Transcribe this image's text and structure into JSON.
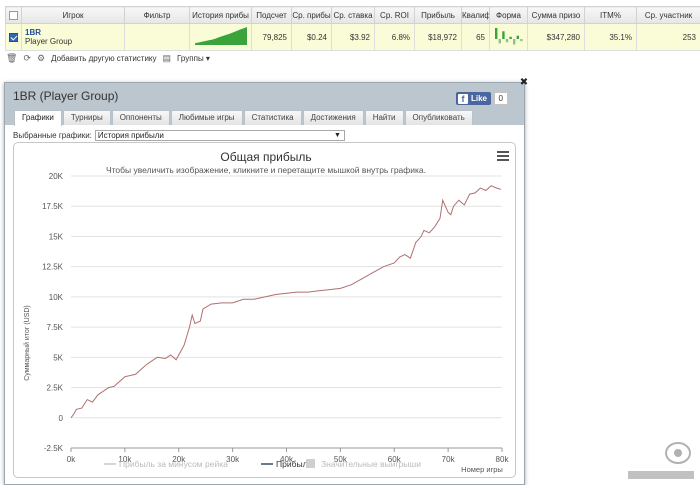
{
  "table": {
    "headers": [
      "",
      "Игрок",
      "Фильтр",
      "История прибы",
      "Подсчет",
      "Ср. прибы",
      "Ср. ставка",
      "Ср. ROI",
      "Прибыль",
      "Квалиф",
      "Форма",
      "Сумма призо",
      "ITM%",
      "Ср. участник"
    ],
    "row": {
      "checked": true,
      "player_name": "1BR",
      "player_sub": "Player Group",
      "filter": "",
      "count": "79,825",
      "avg_profit": "$0.24",
      "avg_stake": "$3.92",
      "avg_roi": "6.8%",
      "profit": "$18,972",
      "qualif": "65",
      "prize_sum": "$347,280",
      "itm": "35.1%",
      "avg_entrants": "253"
    },
    "sparkline": [
      10,
      14,
      18,
      22,
      26,
      30,
      36,
      44,
      50,
      56,
      62,
      70,
      78,
      86,
      92,
      100
    ],
    "form_bars": [
      {
        "v": 10,
        "pos": true
      },
      {
        "v": 4,
        "pos": false
      },
      {
        "v": 7,
        "pos": true
      },
      {
        "v": 3,
        "pos": false
      },
      {
        "v": 2,
        "pos": true
      },
      {
        "v": 5,
        "pos": false
      },
      {
        "v": 3,
        "pos": true
      },
      {
        "v": 2,
        "pos": false
      }
    ],
    "colors": {
      "row_bg": "#fafcd8",
      "spark": "#3aa43a",
      "form_neg": "#8fbf8f",
      "player": "#244c99"
    }
  },
  "toolbar": {
    "add_label": "Добавить другую статистику",
    "groups_label": "Группы"
  },
  "panel": {
    "title": "1BR (Player Group)",
    "fb_like": "Like",
    "fb_count": "0",
    "tabs": [
      "Графики",
      "Турниры",
      "Оппоненты",
      "Любимые игры",
      "Статистика",
      "Достижения",
      "Найти",
      "Опубликовать"
    ],
    "active_tab": 0,
    "select_label": "Выбранные графики:",
    "select_value": "История прибыли"
  },
  "chart_data": {
    "type": "line",
    "title": "Общая прибыль",
    "subtitle": "Чтобы увеличить изображение, кликните и перетащите мышкой внутрь графика.",
    "xlabel": "Номер игры",
    "ylabel": "Суммарный итог (USD)",
    "xlim": [
      0,
      80000
    ],
    "ylim": [
      -2500,
      20000
    ],
    "x_ticks": [
      "0k",
      "10k",
      "20k",
      "30k",
      "40k",
      "50k",
      "60k",
      "70k",
      "80k"
    ],
    "y_ticks": [
      "-2.5K",
      "0",
      "2.5K",
      "5K",
      "7.5K",
      "10K",
      "12.5K",
      "15K",
      "17.5K",
      "20K"
    ],
    "grid": true,
    "legend_position": "bottom",
    "series": [
      {
        "name": "Прибыль за минусом рейка",
        "visible": false,
        "color": "#d0d0d0",
        "x": [],
        "y": []
      },
      {
        "name": "Прибыль",
        "visible": true,
        "color": "#b07070",
        "x": [
          0,
          500,
          1000,
          2000,
          3000,
          4000,
          5000,
          6000,
          7000,
          8000,
          10000,
          12000,
          14000,
          16000,
          17500,
          18500,
          19500,
          21000,
          22000,
          22500,
          23000,
          24000,
          24500,
          26000,
          28000,
          30000,
          32000,
          34000,
          36000,
          38000,
          40000,
          42000,
          44000,
          46000,
          48000,
          50000,
          52000,
          54000,
          56000,
          58000,
          60000,
          61000,
          62000,
          63000,
          64000,
          65000,
          65500,
          66500,
          67500,
          68500,
          69000,
          70000,
          70500,
          71000,
          72000,
          73000,
          74000,
          75000,
          76000,
          77000,
          78000,
          79000,
          79825
        ],
        "y": [
          0,
          300,
          700,
          800,
          1500,
          1300,
          1900,
          2200,
          2500,
          2600,
          3400,
          3600,
          4400,
          5000,
          4900,
          5200,
          4800,
          6000,
          7500,
          8500,
          7800,
          8000,
          9000,
          9400,
          9500,
          9500,
          9800,
          9800,
          10000,
          10200,
          10300,
          10400,
          10400,
          10500,
          10600,
          10700,
          11000,
          11500,
          12000,
          12500,
          12800,
          13300,
          13500,
          13200,
          14500,
          15000,
          15500,
          15300,
          15800,
          16500,
          18000,
          17000,
          16800,
          17500,
          18000,
          17600,
          18500,
          18600,
          19000,
          18800,
          19200,
          19000,
          18900
        ]
      },
      {
        "name": "Значительные выигрыши",
        "visible": false,
        "color": "#c8c8c8",
        "x": [],
        "y": []
      }
    ]
  }
}
